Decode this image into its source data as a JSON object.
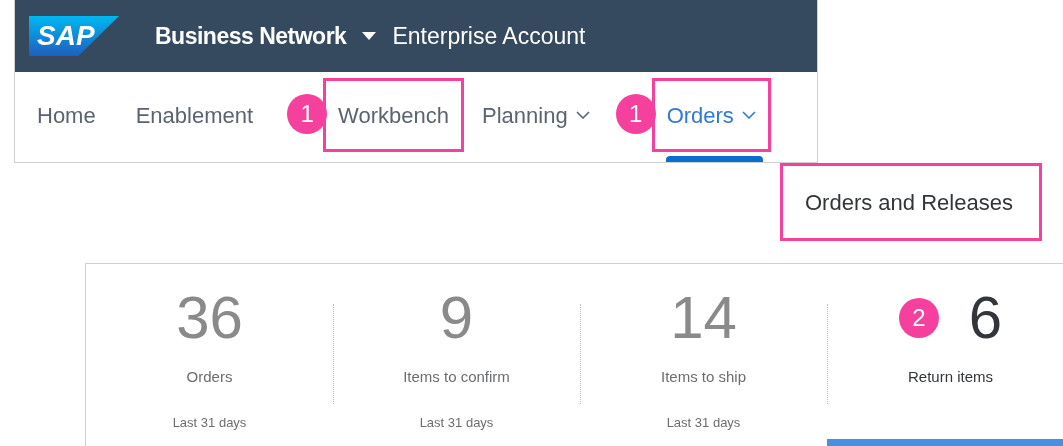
{
  "header": {
    "logo": "SAP",
    "product": "Business Network",
    "account": "Enterprise Account"
  },
  "nav": [
    {
      "label": "Home",
      "selected": false,
      "dropdown": false,
      "highlighted": false
    },
    {
      "label": "Enablement",
      "selected": false,
      "dropdown": false,
      "highlighted": false
    },
    {
      "label": "Workbench",
      "selected": false,
      "dropdown": false,
      "highlighted": true,
      "callout": "1"
    },
    {
      "label": "Planning",
      "selected": false,
      "dropdown": true,
      "highlighted": false
    },
    {
      "label": "Orders",
      "selected": true,
      "dropdown": true,
      "highlighted": true,
      "callout": "1"
    }
  ],
  "menu": [
    {
      "label": "Orders and Releases",
      "highlighted": true
    }
  ],
  "tiles": [
    {
      "value": "36",
      "label": "Orders",
      "period": "Last 31 days",
      "selected": false
    },
    {
      "value": "9",
      "label": "Items to confirm",
      "period": "Last 31 days",
      "selected": false
    },
    {
      "value": "14",
      "label": "Items to ship",
      "period": "Last 31 days",
      "selected": false
    },
    {
      "value": "6",
      "label": "Return items",
      "selected": true,
      "callout": "2"
    }
  ]
}
